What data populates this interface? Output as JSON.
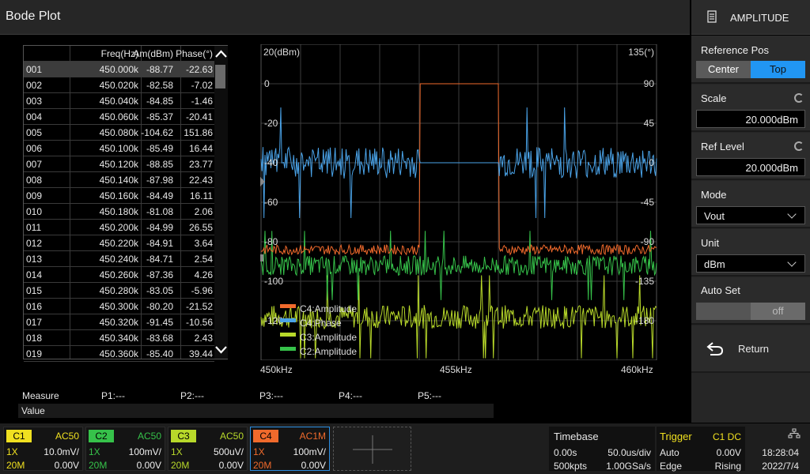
{
  "header": {
    "title": "Bode Plot",
    "menu_label": "AMPLITUDE"
  },
  "table": {
    "headers": [
      "",
      "Freq(Hz)",
      "Am(dBm)",
      "Phase(°)"
    ],
    "rows": [
      [
        "001",
        "450.000k",
        "-88.77",
        "-22.63"
      ],
      [
        "002",
        "450.020k",
        "-82.58",
        "-7.02"
      ],
      [
        "003",
        "450.040k",
        "-84.85",
        "-1.46"
      ],
      [
        "004",
        "450.060k",
        "-85.37",
        "-20.41"
      ],
      [
        "005",
        "450.080k",
        "-104.62",
        "151.86"
      ],
      [
        "006",
        "450.100k",
        "-85.49",
        "16.44"
      ],
      [
        "007",
        "450.120k",
        "-88.85",
        "23.77"
      ],
      [
        "008",
        "450.140k",
        "-87.98",
        "22.43"
      ],
      [
        "009",
        "450.160k",
        "-84.49",
        "16.11"
      ],
      [
        "010",
        "450.180k",
        "-81.08",
        "2.06"
      ],
      [
        "011",
        "450.200k",
        "-84.99",
        "26.55"
      ],
      [
        "012",
        "450.220k",
        "-84.91",
        "3.64"
      ],
      [
        "013",
        "450.240k",
        "-84.71",
        "2.54"
      ],
      [
        "014",
        "450.260k",
        "-87.36",
        "4.26"
      ],
      [
        "015",
        "450.280k",
        "-83.05",
        "-5.96"
      ],
      [
        "016",
        "450.300k",
        "-80.20",
        "-21.52"
      ],
      [
        "017",
        "450.320k",
        "-91.45",
        "-10.56"
      ],
      [
        "018",
        "450.340k",
        "-83.68",
        "2.43"
      ],
      [
        "019",
        "450.360k",
        "-85.40",
        "39.44"
      ]
    ]
  },
  "chart_data": {
    "type": "line",
    "left_unit": "20(dBm)",
    "right_unit": "135(°)",
    "left_ticks": [
      "0",
      "-20",
      "-40",
      "-60",
      "-80",
      "-100",
      "-120"
    ],
    "right_ticks": [
      "90",
      "45",
      "0",
      "-45",
      "-90",
      "-135",
      "-180"
    ],
    "x_ticks": [
      "450kHz",
      "455kHz",
      "460kHz"
    ],
    "x_range_khz": [
      450,
      460
    ],
    "amplitude_range_dbm": [
      -140,
      20
    ],
    "phase_range_deg": [
      -225,
      135
    ],
    "series": [
      {
        "name": "C4:Amplitude",
        "color": "#f06a2c",
        "approx_level_dbm": -84,
        "gap_khz": [
          454,
          456
        ],
        "gap_level_dbm": 0
      },
      {
        "name": "C4:Phase",
        "color": "#4aa3e8",
        "approx_level_deg": 0,
        "gap_khz": [
          454,
          456
        ]
      },
      {
        "name": "C3:Amplitude",
        "color": "#b8d92a",
        "approx_level_dbm": -118
      },
      {
        "name": "C2:Amplitude",
        "color": "#36c24a",
        "approx_level_dbm": -92
      }
    ]
  },
  "measure": {
    "label": "Measure",
    "items": [
      "P1:---",
      "P2:---",
      "P3:---",
      "P4:---",
      "P5:---"
    ],
    "value_label": "Value"
  },
  "right_panel": {
    "reference_pos": {
      "label": "Reference Pos",
      "options": [
        "Center",
        "Top"
      ],
      "selected": "Top"
    },
    "scale": {
      "label": "Scale",
      "value": "20.000dBm"
    },
    "ref_level": {
      "label": "Ref Level",
      "value": "20.000dBm"
    },
    "mode": {
      "label": "Mode",
      "value": "Vout"
    },
    "unit": {
      "label": "Unit",
      "value": "dBm"
    },
    "auto_set": {
      "label": "Auto Set",
      "value": "off"
    },
    "return_label": "Return"
  },
  "channels": [
    {
      "tag": "C1",
      "color": "#f0e020",
      "coupling": "AC50",
      "probe": "1X",
      "volts": "10.0mV/",
      "bw": "20M",
      "offset": "0.00V"
    },
    {
      "tag": "C2",
      "color": "#36c24a",
      "coupling": "AC50",
      "probe": "1X",
      "volts": "100mV/",
      "bw": "20M",
      "offset": "0.00V"
    },
    {
      "tag": "C3",
      "color": "#b8d92a",
      "coupling": "AC50",
      "probe": "1X",
      "volts": "500uV/",
      "bw": "20M",
      "offset": "0.00V"
    },
    {
      "tag": "C4",
      "color": "#f06a2c",
      "coupling": "AC1M",
      "probe": "1X",
      "volts": "100mV/",
      "bw": "20M",
      "offset": "0.00V"
    }
  ],
  "timebase": {
    "label": "Timebase",
    "delay": "0.00s",
    "scale": "50.0us/div",
    "points": "500kpts",
    "rate": "1.00GSa/s"
  },
  "trigger": {
    "label": "Trigger",
    "source": "C1 DC",
    "mode": "Auto",
    "level": "0.00V",
    "type": "Edge",
    "slope": "Rising"
  },
  "clock": {
    "time": "18:28:04",
    "date": "2022/7/4"
  }
}
